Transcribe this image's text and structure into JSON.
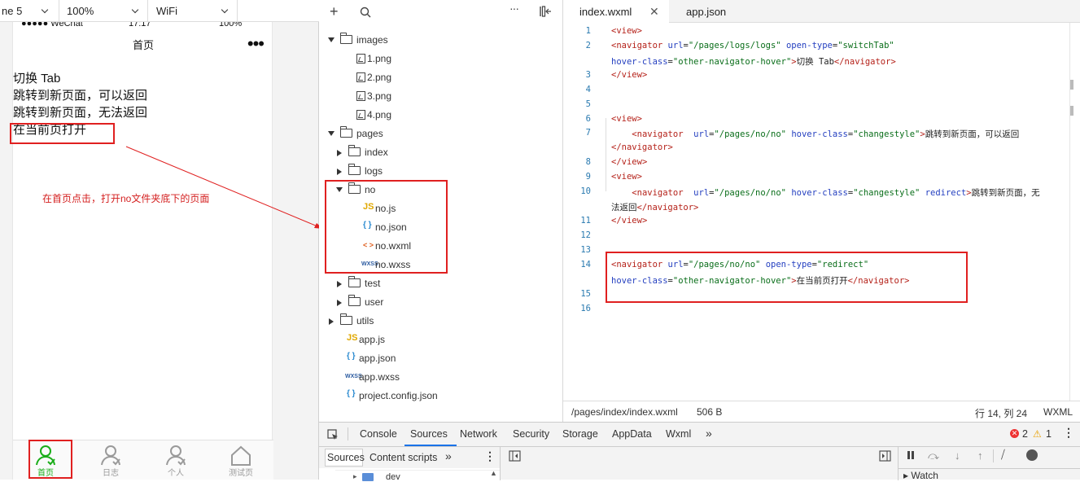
{
  "toolbar": {
    "device": "ne 5",
    "zoom": "100%",
    "network": "WiFi"
  },
  "phone": {
    "status": {
      "carrier": "●●●●● WeChat",
      "time": "17:17",
      "battery": "100%"
    },
    "title": "首页",
    "links": [
      "切换 Tab",
      "跳转到新页面，可以返回",
      "跳转到新页面，无法返回",
      "在当前页打开"
    ],
    "tabs": [
      {
        "label": "首页",
        "active": true,
        "icon": "user-icon"
      },
      {
        "label": "日志",
        "active": false,
        "icon": "user-icon"
      },
      {
        "label": "个人",
        "active": false,
        "icon": "user-icon"
      },
      {
        "label": "测试页",
        "active": false,
        "icon": "home-icon"
      }
    ]
  },
  "annotation": "在首页点击，打开no文件夹底下的页面",
  "explorer": {
    "tree": [
      {
        "name": "images",
        "type": "folder",
        "open": true,
        "depth": 0
      },
      {
        "name": "1.png",
        "type": "image",
        "depth": 1
      },
      {
        "name": "2.png",
        "type": "image",
        "depth": 1
      },
      {
        "name": "3.png",
        "type": "image",
        "depth": 1
      },
      {
        "name": "4.png",
        "type": "image",
        "depth": 1
      },
      {
        "name": "pages",
        "type": "folder",
        "open": true,
        "depth": 0
      },
      {
        "name": "index",
        "type": "folder",
        "open": false,
        "depth": 1
      },
      {
        "name": "logs",
        "type": "folder",
        "open": false,
        "depth": 1
      },
      {
        "name": "no",
        "type": "folder",
        "open": true,
        "depth": 1
      },
      {
        "name": "no.js",
        "type": "js",
        "depth": 2
      },
      {
        "name": "no.json",
        "type": "json",
        "depth": 2
      },
      {
        "name": "no.wxml",
        "type": "wxml",
        "depth": 2
      },
      {
        "name": "no.wxss",
        "type": "wxss",
        "depth": 2
      },
      {
        "name": "test",
        "type": "folder",
        "open": false,
        "depth": 1
      },
      {
        "name": "user",
        "type": "folder",
        "open": false,
        "depth": 1
      },
      {
        "name": "utils",
        "type": "folder",
        "open": false,
        "depth": 0
      },
      {
        "name": "app.js",
        "type": "js",
        "depth": 0
      },
      {
        "name": "app.json",
        "type": "json",
        "depth": 0
      },
      {
        "name": "app.wxss",
        "type": "wxss",
        "depth": 0
      },
      {
        "name": "project.config.json",
        "type": "json",
        "depth": 0
      }
    ]
  },
  "editor": {
    "tabs": [
      "index.wxml",
      "app.json"
    ],
    "line_numbers": [
      "1",
      "2",
      "3",
      "4",
      "5",
      "6",
      "7",
      "8",
      "9",
      "10",
      "11",
      "12",
      "13",
      "14",
      "15",
      "16"
    ],
    "code": [
      "<view>",
      "<navigator url=\"/pages/logs/logs\" open-type=\"switchTab\"",
      "hover-class=\"other-navigator-hover\">切换 Tab</navigator>",
      "</view>",
      "<view>",
      "    <navigator  url=\"/pages/no/no\" hover-class=\"changestyle\">跳转到新页面，可以返回",
      "</navigator>",
      "</view>",
      "<view>",
      "    <navigator  url=\"/pages/no/no\" hover-class=\"changestyle\" redirect>跳转到新页面，无",
      "法返回</navigator>",
      "</view>",
      "<navigator url=\"/pages/no/no\" open-type=\"redirect\"",
      "hover-class=\"other-navigator-hover\">在当前页打开</navigator>"
    ],
    "status": {
      "path": "/pages/index/index.wxml",
      "size": "506 B",
      "cursor": "行 14, 列 24",
      "lang": "WXML"
    }
  },
  "devtools": {
    "tabs": [
      "Console",
      "Sources",
      "Network",
      "Security",
      "Storage",
      "AppData",
      "Wxml"
    ],
    "more": "»",
    "errors": "2",
    "warnings": "1",
    "subtabs": [
      "Sources",
      "Content scripts"
    ],
    "tree_item": "dev",
    "watch": "Watch"
  },
  "colors": {
    "red": "#e02020",
    "green": "#1aad19",
    "tag": "#b5221a",
    "attr": "#2540c0",
    "value": "#0a6e1a"
  }
}
